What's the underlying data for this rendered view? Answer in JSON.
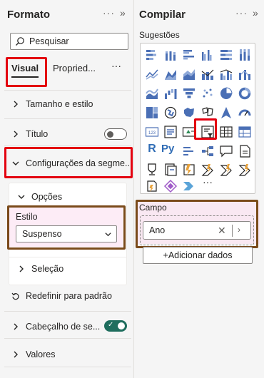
{
  "format_pane": {
    "title": "Formato",
    "more": "···",
    "collapse": "»",
    "search_placeholder": "Pesquisar",
    "tabs": {
      "visual": "Visual",
      "properties": "Propried...",
      "more": "···"
    },
    "sections": {
      "size_style": "Tamanho e estilo",
      "title": "Título",
      "slicer_settings": "Configurações da segme...",
      "options": "Opções",
      "style_label": "Estilo",
      "style_value": "Suspenso",
      "selection": "Seleção",
      "reset": "Redefinir para padrão",
      "header": "Cabeçalho de se...",
      "values": "Valores"
    }
  },
  "build_pane": {
    "title": "Compilar",
    "more": "···",
    "collapse": "»",
    "suggestions": "Sugestões",
    "more_visuals": "···",
    "field_label": "Campo",
    "field_value": "Ano",
    "add_data": "+Adicionar dados",
    "r_label": "R",
    "py_label": "Py"
  },
  "colors": {
    "accent_red": "#e3000f",
    "highlight_brown": "#7a4a1a",
    "toggle_on": "#1f6e5e",
    "pink": "#fcdcef"
  }
}
